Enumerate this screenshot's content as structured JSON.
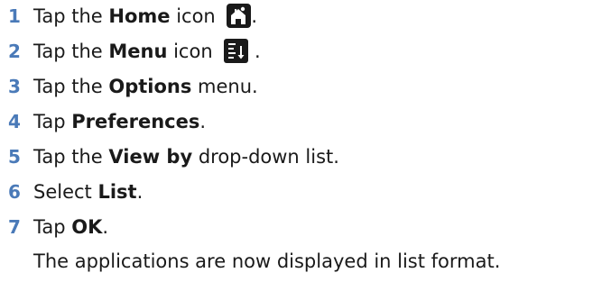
{
  "steps": [
    {
      "number": "1",
      "parts": {
        "a": "Tap the ",
        "b": "Home",
        "c": " icon ",
        "d": "."
      },
      "icon": "home-icon"
    },
    {
      "number": "2",
      "parts": {
        "a": "Tap the ",
        "b": "Menu",
        "c": " icon ",
        "d": " ."
      },
      "icon": "menu-icon"
    },
    {
      "number": "3",
      "parts": {
        "a": "Tap the ",
        "b": "Options",
        "c": " menu."
      }
    },
    {
      "number": "4",
      "parts": {
        "a": "Tap ",
        "b": "Preferences",
        "c": "."
      }
    },
    {
      "number": "5",
      "parts": {
        "a": "Tap the ",
        "b": "View by",
        "c": " drop-down list."
      }
    },
    {
      "number": "6",
      "parts": {
        "a": "Select ",
        "b": "List",
        "c": "."
      }
    },
    {
      "number": "7",
      "parts": {
        "a": "Tap ",
        "b": "OK",
        "c": "."
      }
    }
  ],
  "result_note": "The applications are now displayed in list format.",
  "colors": {
    "step_number": "#4a7ab8",
    "text": "#1a1a1a",
    "icon_bg": "#1a1a1a"
  }
}
